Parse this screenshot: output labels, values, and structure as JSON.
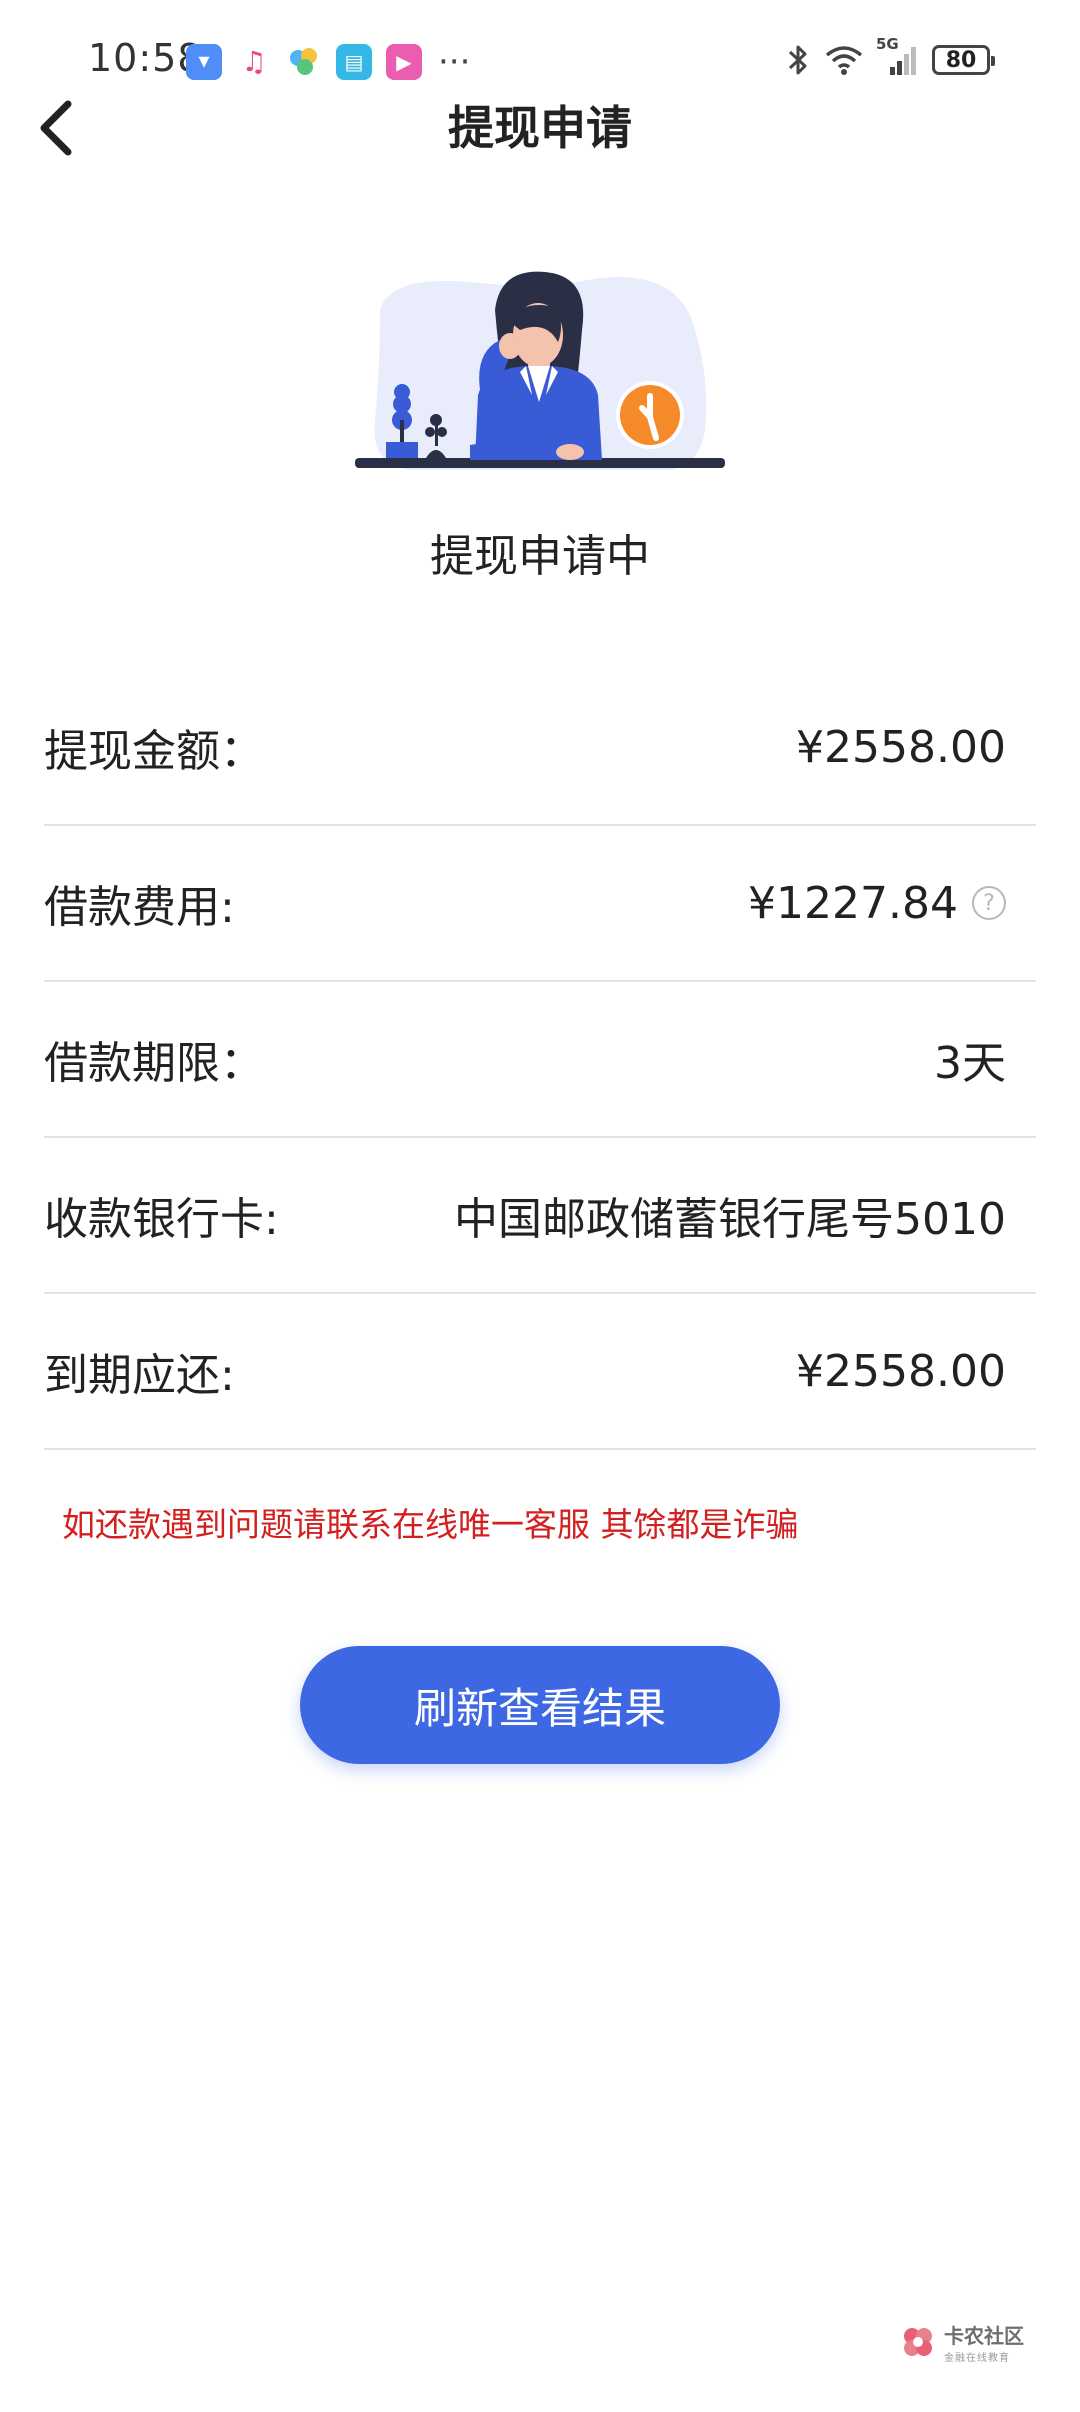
{
  "status_bar": {
    "time": "10:58",
    "network": "5G",
    "battery": "80",
    "more": "···"
  },
  "header": {
    "title": "提现申请"
  },
  "status": {
    "heading": "提现申请中"
  },
  "details": {
    "amount_label": "提现金额：",
    "amount_value": "¥2558.00",
    "fee_label": "借款费用:",
    "fee_value": "¥1227.84",
    "term_label": "借款期限：",
    "term_value": "3天",
    "card_label": "收款银行卡:",
    "card_value": "中国邮政储蓄银行尾号5010",
    "due_label": "到期应还:",
    "due_value": "¥2558.00"
  },
  "notice": {
    "text": "如还款遇到问题请联系在线唯一客服 其馀都是诈骗"
  },
  "actions": {
    "refresh_label": "刷新查看结果"
  },
  "watermark": {
    "title": "卡农社区",
    "subtitle": "金融在线教育"
  },
  "colors": {
    "accent": "#3e68e3",
    "warning": "#d21f1f",
    "illustration_orange": "#f58a2a",
    "illustration_blue": "#3a5bd6"
  }
}
